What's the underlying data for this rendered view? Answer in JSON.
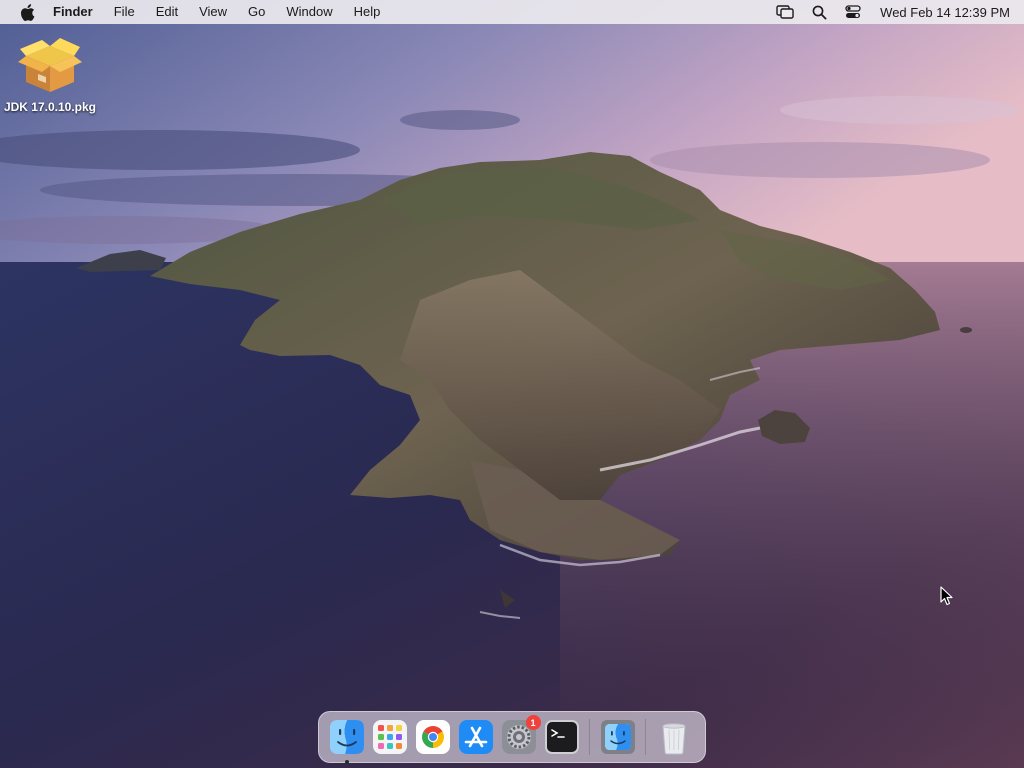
{
  "menubar": {
    "apple_icon": "apple-logo-icon",
    "app_name": "Finder",
    "menus": [
      "File",
      "Edit",
      "View",
      "Go",
      "Window",
      "Help"
    ],
    "status_icons": [
      "screen-mirroring-icon",
      "spotlight-search-icon",
      "control-center-icon"
    ],
    "clock": "Wed Feb 14  12:39 PM"
  },
  "desktop": {
    "wallpaper": "macOS Catalina island",
    "icons": [
      {
        "label": "JDK 17.0.10.pkg",
        "icon": "package-icon"
      }
    ]
  },
  "dock": {
    "apps": [
      {
        "name": "Finder",
        "icon": "finder-icon",
        "running": true
      },
      {
        "name": "Launchpad",
        "icon": "launchpad-icon",
        "running": false
      },
      {
        "name": "Google Chrome",
        "icon": "chrome-icon",
        "running": false
      },
      {
        "name": "App Store",
        "icon": "app-store-icon",
        "running": false
      },
      {
        "name": "System Preferences",
        "icon": "system-preferences-icon",
        "running": false,
        "badge": "1"
      },
      {
        "name": "Terminal",
        "icon": "terminal-icon",
        "running": false
      }
    ],
    "extras": [
      {
        "name": "Finder",
        "icon": "finder-icon"
      }
    ],
    "trash": {
      "name": "Trash",
      "icon": "trash-icon"
    }
  },
  "colors": {
    "menubar_bg": "#ece9ee",
    "badge": "#f0413a",
    "finder_blue": "#2e8ff0",
    "app_store_blue": "#1f8cf5"
  }
}
